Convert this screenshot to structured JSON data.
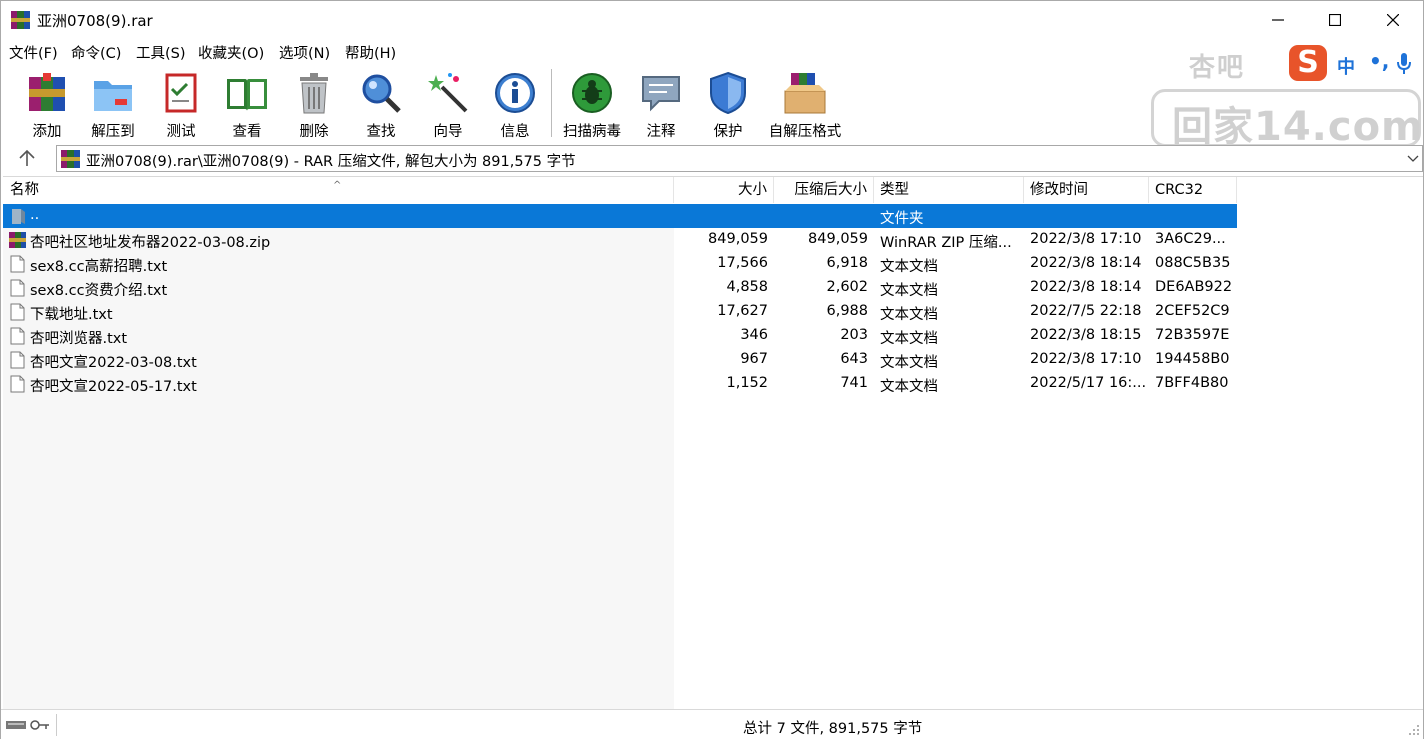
{
  "window": {
    "title": "亚洲0708(9).rar"
  },
  "menu": [
    "文件(F)",
    "命令(C)",
    "工具(S)",
    "收藏夹(O)",
    "选项(N)",
    "帮助(H)"
  ],
  "toolbar": [
    {
      "label": "添加",
      "icon": "add-icon"
    },
    {
      "label": "解压到",
      "icon": "extract-to-icon"
    },
    {
      "label": "测试",
      "icon": "test-icon"
    },
    {
      "label": "查看",
      "icon": "view-icon"
    },
    {
      "label": "删除",
      "icon": "delete-icon"
    },
    {
      "label": "查找",
      "icon": "find-icon"
    },
    {
      "label": "向导",
      "icon": "wizard-icon"
    },
    {
      "label": "信息",
      "icon": "info-icon"
    },
    {
      "label": "扫描病毒",
      "icon": "virus-scan-icon"
    },
    {
      "label": "注释",
      "icon": "comment-icon"
    },
    {
      "label": "保护",
      "icon": "protect-icon"
    },
    {
      "label": "自解压格式",
      "icon": "sfx-icon"
    }
  ],
  "watermark": {
    "top": "杏吧",
    "main": "回家14.com"
  },
  "ime": {
    "logo": "S",
    "mode": "中",
    "punct": "•,"
  },
  "address": {
    "path": "亚洲0708(9).rar\\亚洲0708(9) - RAR 压缩文件, 解包大小为 891,575 字节"
  },
  "columns": {
    "name": "名称",
    "size": "大小",
    "packed": "压缩后大小",
    "type": "类型",
    "modified": "修改时间",
    "crc": "CRC32"
  },
  "files": [
    {
      "name": "..",
      "size": "",
      "packed": "",
      "type": "文件夹",
      "modified": "",
      "crc": "",
      "selected": true,
      "icon": "folder-up-icon"
    },
    {
      "name": "杏吧社区地址发布器2022-03-08.zip",
      "size": "849,059",
      "packed": "849,059",
      "type": "WinRAR ZIP 压缩...",
      "modified": "2022/3/8 17:10",
      "crc": "3A6C29...",
      "icon": "zip-archive-icon"
    },
    {
      "name": "sex8.cc高薪招聘.txt",
      "size": "17,566",
      "packed": "6,918",
      "type": "文本文档",
      "modified": "2022/3/8 18:14",
      "crc": "088C5B35",
      "icon": "text-file-icon"
    },
    {
      "name": "sex8.cc资费介绍.txt",
      "size": "4,858",
      "packed": "2,602",
      "type": "文本文档",
      "modified": "2022/3/8 18:14",
      "crc": "DE6AB922",
      "icon": "text-file-icon"
    },
    {
      "name": "下载地址.txt",
      "size": "17,627",
      "packed": "6,988",
      "type": "文本文档",
      "modified": "2022/7/5 22:18",
      "crc": "2CEF52C9",
      "icon": "text-file-icon"
    },
    {
      "name": "杏吧浏览器.txt",
      "size": "346",
      "packed": "203",
      "type": "文本文档",
      "modified": "2022/3/8 18:15",
      "crc": "72B3597E",
      "icon": "text-file-icon"
    },
    {
      "name": "杏吧文宣2022-03-08.txt",
      "size": "967",
      "packed": "643",
      "type": "文本文档",
      "modified": "2022/3/8 17:10",
      "crc": "194458B0",
      "icon": "text-file-icon"
    },
    {
      "name": "杏吧文宣2022-05-17.txt",
      "size": "1,152",
      "packed": "741",
      "type": "文本文档",
      "modified": "2022/5/17 16:...",
      "crc": "7BFF4B80",
      "icon": "text-file-icon"
    }
  ],
  "status": {
    "text": "总计 7 文件, 891,575 字节"
  },
  "colors": {
    "selection": "#0a78d7",
    "ime_logo": "#e8542a",
    "ime_text": "#1e72d8"
  }
}
